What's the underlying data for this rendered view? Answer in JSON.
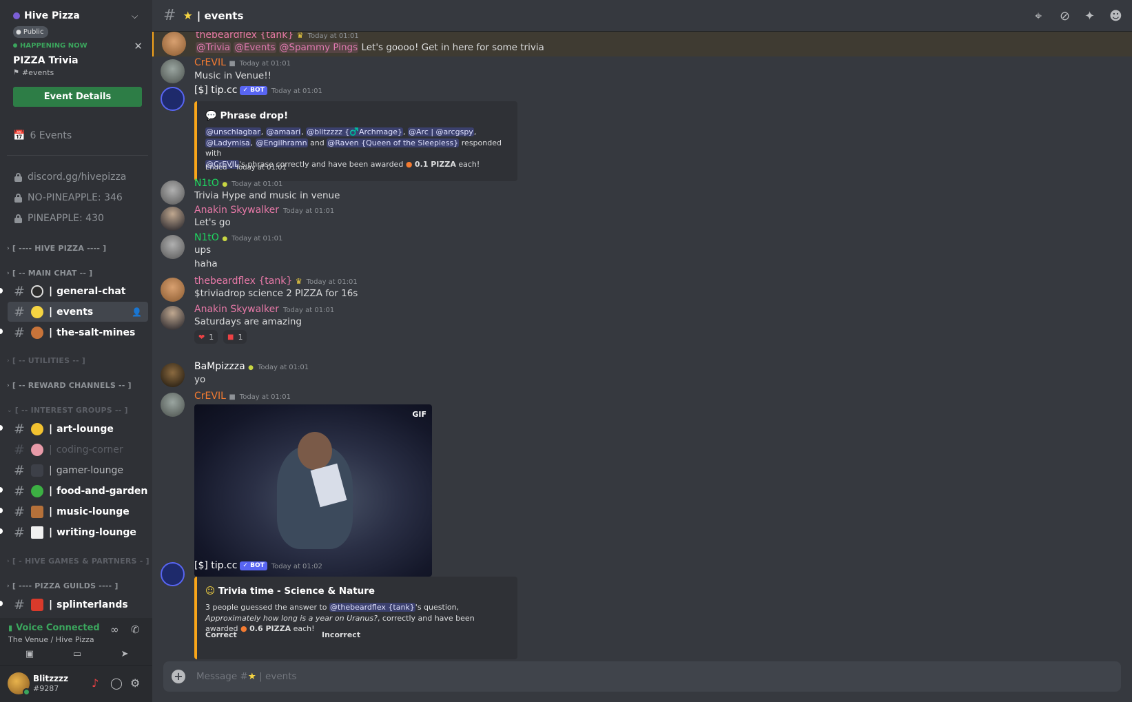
{
  "sidebar": {
    "guild_name": "Hive Pizza",
    "public_badge": "Public",
    "event": {
      "status": "HAPPENING NOW",
      "title": "PIZZA Trivia",
      "location": "#events",
      "button": "Event Details"
    },
    "events_count": "6 Events",
    "locked_channels": [
      "discord.gg/hivepizza",
      "NO-PINEAPPLE: 346",
      "PINEAPPLE: 430"
    ],
    "categories": {
      "hive_pizza": "[ ---- HIVE PIZZA ---- ]",
      "main_chat": "[ -- MAIN CHAT -- ]",
      "utilities": "[ -- UTILITIES -- ]",
      "reward": "[ -- REWARD CHANNELS -- ]",
      "interest": "[ -- INTEREST GROUPS -- ]",
      "hive_games": "[ - HIVE GAMES & PARTNERS - ]",
      "pizza_guilds": "[ ---- PIZZA GUILDS ---- ]"
    },
    "channels": {
      "general": "general-chat",
      "events": "events",
      "salt": "the-salt-mines",
      "art": "art-lounge",
      "coding": "coding-corner",
      "gamer": "gamer-lounge",
      "food": "food-and-garden",
      "music": "music-lounge",
      "writing": "writing-lounge",
      "splinter": "splinterlands"
    },
    "voice": {
      "status": "Voice Connected",
      "location": "The Venue / Hive Pizza"
    },
    "user": {
      "name": "Blitzzzz",
      "tag": "#9287"
    }
  },
  "header": {
    "channel": "events"
  },
  "messages": {
    "m1": {
      "author": "thebeardflex {tank}",
      "time": "Today at 01:01",
      "mentions": [
        "@Trivia",
        "@Events",
        "@Spammy Pings"
      ],
      "text": "Let's goooo! Get in here for some trivia"
    },
    "m2": {
      "author": "CrEVIL",
      "time": "Today at 01:01",
      "text": "Music in Venue!!"
    },
    "m3": {
      "author": "[$] tip.cc",
      "bot": "✓ BOT",
      "time": "Today at 01:01",
      "embed": {
        "title": "Phrase drop!",
        "users": [
          "@unschlagbar",
          "@amaari",
          "@blitzzzz {♂️Archmage️}",
          "@Arc | @arcgspy",
          "@Ladymisa",
          "@Engilhramn",
          "@Raven {Queen of the Sleepless}"
        ],
        "responded": "responded with",
        "phrase_user": "@CrEVIL",
        "phrase_tail": "'s phrase correctly and have been awarded",
        "amount": "0.1 PIZZA",
        "each": "each!",
        "and": "and",
        "footer": "Ended • Today at 01:01"
      }
    },
    "m4": {
      "author": "N1tO",
      "time": "Today at 01:01",
      "text": "Trivia Hype and music in venue"
    },
    "m5": {
      "author": "Anakin Skywalker",
      "time": "Today at 01:01",
      "text": "Let's go"
    },
    "m6": {
      "author": "N1tO",
      "time": "Today at 01:01",
      "text": "ups",
      "text2": "haha"
    },
    "m7": {
      "author": "thebeardflex {tank}",
      "time": "Today at 01:01",
      "text": "$triviadrop science 2 PIZZA for 16s"
    },
    "m8": {
      "author": "Anakin Skywalker",
      "time": "Today at 01:01",
      "text": "Saturdays are amazing",
      "reactions": [
        "1",
        "1"
      ]
    },
    "m9": {
      "author": "BaMpizzza",
      "time": "Today at 01:01",
      "text": "yo"
    },
    "m10": {
      "author": "CrEVIL",
      "time": "Today at 01:01",
      "gif": "GIF"
    },
    "m11": {
      "author": "[$] tip.cc",
      "bot": "✓ BOT",
      "time": "Today at 01:02",
      "embed": {
        "title": "Trivia time - Science & Nature",
        "line_a": "3 people guessed the answer to",
        "mention": "@thebeardflex {tank}",
        "line_b": "'s question,",
        "question": "Approximately how long is a year on Uranus?",
        "line_c": ", correctly and have been awarded",
        "amount": "0.6 PIZZA",
        "each": "each!",
        "col1": "Correct",
        "col2": "Incorrect"
      }
    }
  },
  "composer": {
    "placeholder_prefix": "Message #",
    "placeholder_channel": "events"
  },
  "colors": {
    "accent_green": "#3ba55d",
    "mention_pink": "#e07ab0",
    "orange_name": "#f47b31",
    "green_name": "#1ed760",
    "pink_name": "#e879a8",
    "blurple": "#5865f2"
  }
}
